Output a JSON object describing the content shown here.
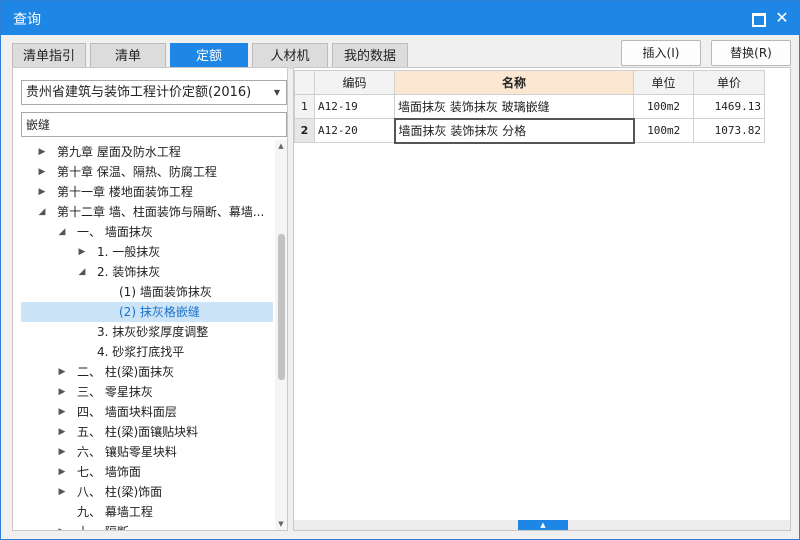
{
  "window": {
    "title": "查询"
  },
  "tabs": [
    {
      "label": "清单指引"
    },
    {
      "label": "清单"
    },
    {
      "label": "定额",
      "active": true
    },
    {
      "label": "人材机"
    },
    {
      "label": "我的数据"
    }
  ],
  "toolbar": {
    "insert_label": "插入(I)",
    "replace_label": "替换(R)"
  },
  "left": {
    "library": "贵州省建筑与装饰工程计价定额(2016)",
    "search_value": "嵌缝",
    "tree": [
      {
        "label": "第九章 屋面及防水工程",
        "level": 0,
        "arrow": "collapsed"
      },
      {
        "label": "第十章 保温、隔热、防腐工程",
        "level": 0,
        "arrow": "collapsed"
      },
      {
        "label": "第十一章 楼地面装饰工程",
        "level": 0,
        "arrow": "collapsed"
      },
      {
        "label": "第十二章 墙、柱面装饰与隔断、幕墙...",
        "level": 0,
        "arrow": "expanded"
      },
      {
        "label": "一、 墙面抹灰",
        "level": 1,
        "arrow": "expanded"
      },
      {
        "label": "1. 一般抹灰",
        "level": 2,
        "arrow": "collapsed"
      },
      {
        "label": "2. 装饰抹灰",
        "level": 2,
        "arrow": "expanded"
      },
      {
        "label": "(1) 墙面装饰抹灰",
        "level": 3,
        "arrow": "none"
      },
      {
        "label": "(2) 抹灰格嵌缝",
        "level": 3,
        "arrow": "none",
        "selected": true
      },
      {
        "label": "3. 抹灰砂浆厚度调整",
        "level": 2,
        "arrow": "none"
      },
      {
        "label": "4. 砂浆打底找平",
        "level": 2,
        "arrow": "none"
      },
      {
        "label": "二、 柱(梁)面抹灰",
        "level": 1,
        "arrow": "collapsed"
      },
      {
        "label": "三、 零星抹灰",
        "level": 1,
        "arrow": "collapsed"
      },
      {
        "label": "四、 墙面块料面层",
        "level": 1,
        "arrow": "collapsed"
      },
      {
        "label": "五、 柱(梁)面镶贴块料",
        "level": 1,
        "arrow": "collapsed"
      },
      {
        "label": "六、 镶贴零星块料",
        "level": 1,
        "arrow": "collapsed"
      },
      {
        "label": "七、 墙饰面",
        "level": 1,
        "arrow": "collapsed"
      },
      {
        "label": "八、 柱(梁)饰面",
        "level": 1,
        "arrow": "collapsed"
      },
      {
        "label": "九、 幕墙工程",
        "level": 1,
        "arrow": "none"
      },
      {
        "label": "十、 隔断",
        "level": 1,
        "arrow": "collapsed"
      }
    ]
  },
  "table": {
    "headers": {
      "code": "编码",
      "name": "名称",
      "unit": "单位",
      "price": "单价"
    },
    "rows": [
      {
        "num": "1",
        "code": "A12-19",
        "name": "墙面抹灰 装饰抹灰 玻璃嵌缝",
        "unit": "100m2",
        "price": "1469.13"
      },
      {
        "num": "2",
        "code": "A12-20",
        "name": "墙面抹灰 装饰抹灰 分格",
        "unit": "100m2",
        "price": "1073.82",
        "current": true
      }
    ]
  },
  "colors": {
    "accent": "#1e86e4",
    "selected_row_bg": "#cce4f7",
    "name_header_bg": "#fce8d2"
  },
  "icons": {
    "maximize": "maximize-icon",
    "close": "close-icon",
    "dropdown": "chevron-down-icon"
  }
}
